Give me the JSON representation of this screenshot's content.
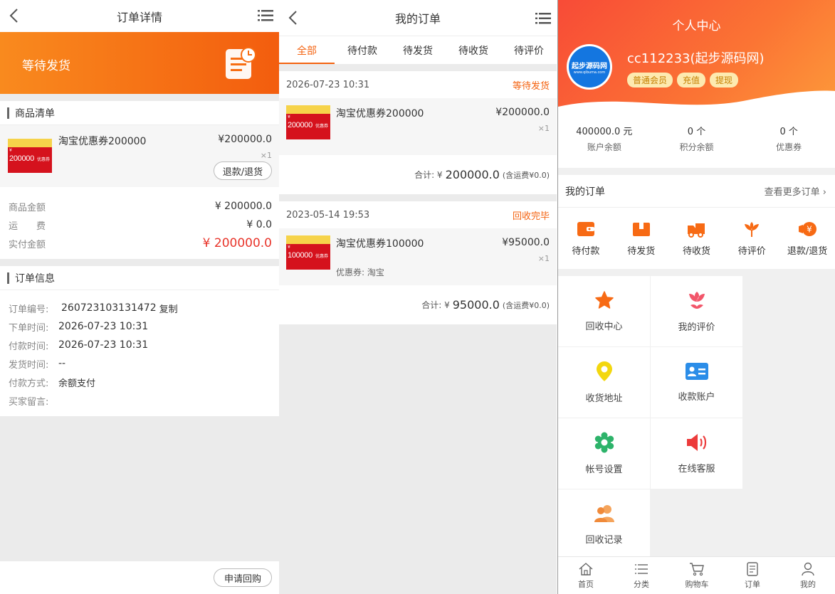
{
  "detail": {
    "title": "订单详情",
    "status": "等待发货",
    "goods_section": "商品清单",
    "item": {
      "name": "淘宝优惠券200000",
      "price": "¥200000.0",
      "qty": "×1",
      "refund_btn": "退款/退货",
      "coupon_num": "200000",
      "coupon_label": "优惠券",
      "coupon_yen": "¥"
    },
    "amount_label": "商品金额",
    "amount_value": "¥ 200000.0",
    "freight_label": "运　　费",
    "freight_value": "¥ 0.0",
    "paid_label": "实付金额",
    "paid_value": "¥ 200000.0",
    "info_section": "订单信息",
    "order_no_label": "订单编号:",
    "order_no": "260723103131472",
    "copy": "复制",
    "order_time_label": "下单时间:",
    "order_time": "2026-07-23 10:31",
    "pay_time_label": "付款时间:",
    "pay_time": "2026-07-23 10:31",
    "ship_time_label": "发货时间:",
    "ship_time": "--",
    "pay_method_label": "付款方式:",
    "pay_method": "余额支付",
    "message_label": "买家留言:",
    "buyback_btn": "申请回购",
    "accent": "#f4620f"
  },
  "orders": {
    "title": "我的订单",
    "tabs": [
      "全部",
      "待付款",
      "待发货",
      "待收货",
      "待评价"
    ],
    "list": [
      {
        "time": "2026-07-23 10:31",
        "status": "等待发货",
        "name": "淘宝优惠券200000",
        "price": "¥200000.0",
        "qty": "×1",
        "sub": "",
        "total_label": "合计: ¥",
        "total": "200000.0",
        "freight": "(含运费¥0.0)",
        "coupon_num": "200000",
        "coupon_label": "优惠券",
        "coupon_yen": "¥"
      },
      {
        "time": "2023-05-14 19:53",
        "status": "回收完毕",
        "name": "淘宝优惠券100000",
        "price": "¥95000.0",
        "qty": "×1",
        "sub": "优惠券: 淘宝",
        "total_label": "合计: ¥",
        "total": "95000.0",
        "freight": "(含运费¥0.0)",
        "coupon_num": "100000",
        "coupon_label": "优惠券",
        "coupon_yen": "¥"
      }
    ]
  },
  "profile": {
    "title": "个人中心",
    "logo_text": "起步源码网",
    "logo_url": "www.qibuma.com",
    "username": "cc112233(起步源码网)",
    "badges": [
      "普通会员",
      "充值",
      "提现"
    ],
    "stats": [
      {
        "value": "400000.0 元",
        "label": "账户余额"
      },
      {
        "value": "0 个",
        "label": "积分余额"
      },
      {
        "value": "0 个",
        "label": "优惠券"
      }
    ],
    "my_orders": "我的订单",
    "more_orders": "查看更多订单",
    "order_icons": [
      {
        "label": "待付款",
        "icon": "wallet-icon"
      },
      {
        "label": "待发货",
        "icon": "box-icon"
      },
      {
        "label": "待收货",
        "icon": "truck-icon"
      },
      {
        "label": "待评价",
        "icon": "flower-icon"
      },
      {
        "label": "退款/退货",
        "icon": "yen-coin-icon"
      }
    ],
    "grid": [
      {
        "label": "回收中心",
        "icon": "star-icon"
      },
      {
        "label": "我的评价",
        "icon": "tulip-icon"
      },
      {
        "label": "收货地址",
        "icon": "location-pin-icon"
      },
      {
        "label": "收款账户",
        "icon": "id-card-icon"
      },
      {
        "label": "帐号设置",
        "icon": "gear-icon"
      },
      {
        "label": "在线客服",
        "icon": "speaker-icon"
      },
      {
        "label": "回收记录",
        "icon": "users-icon"
      }
    ],
    "nav": [
      {
        "label": "首页",
        "icon": "home-icon"
      },
      {
        "label": "分类",
        "icon": "list-icon"
      },
      {
        "label": "购物车",
        "icon": "cart-icon"
      },
      {
        "label": "订单",
        "icon": "order-icon"
      },
      {
        "label": "我的",
        "icon": "user-icon"
      }
    ]
  }
}
